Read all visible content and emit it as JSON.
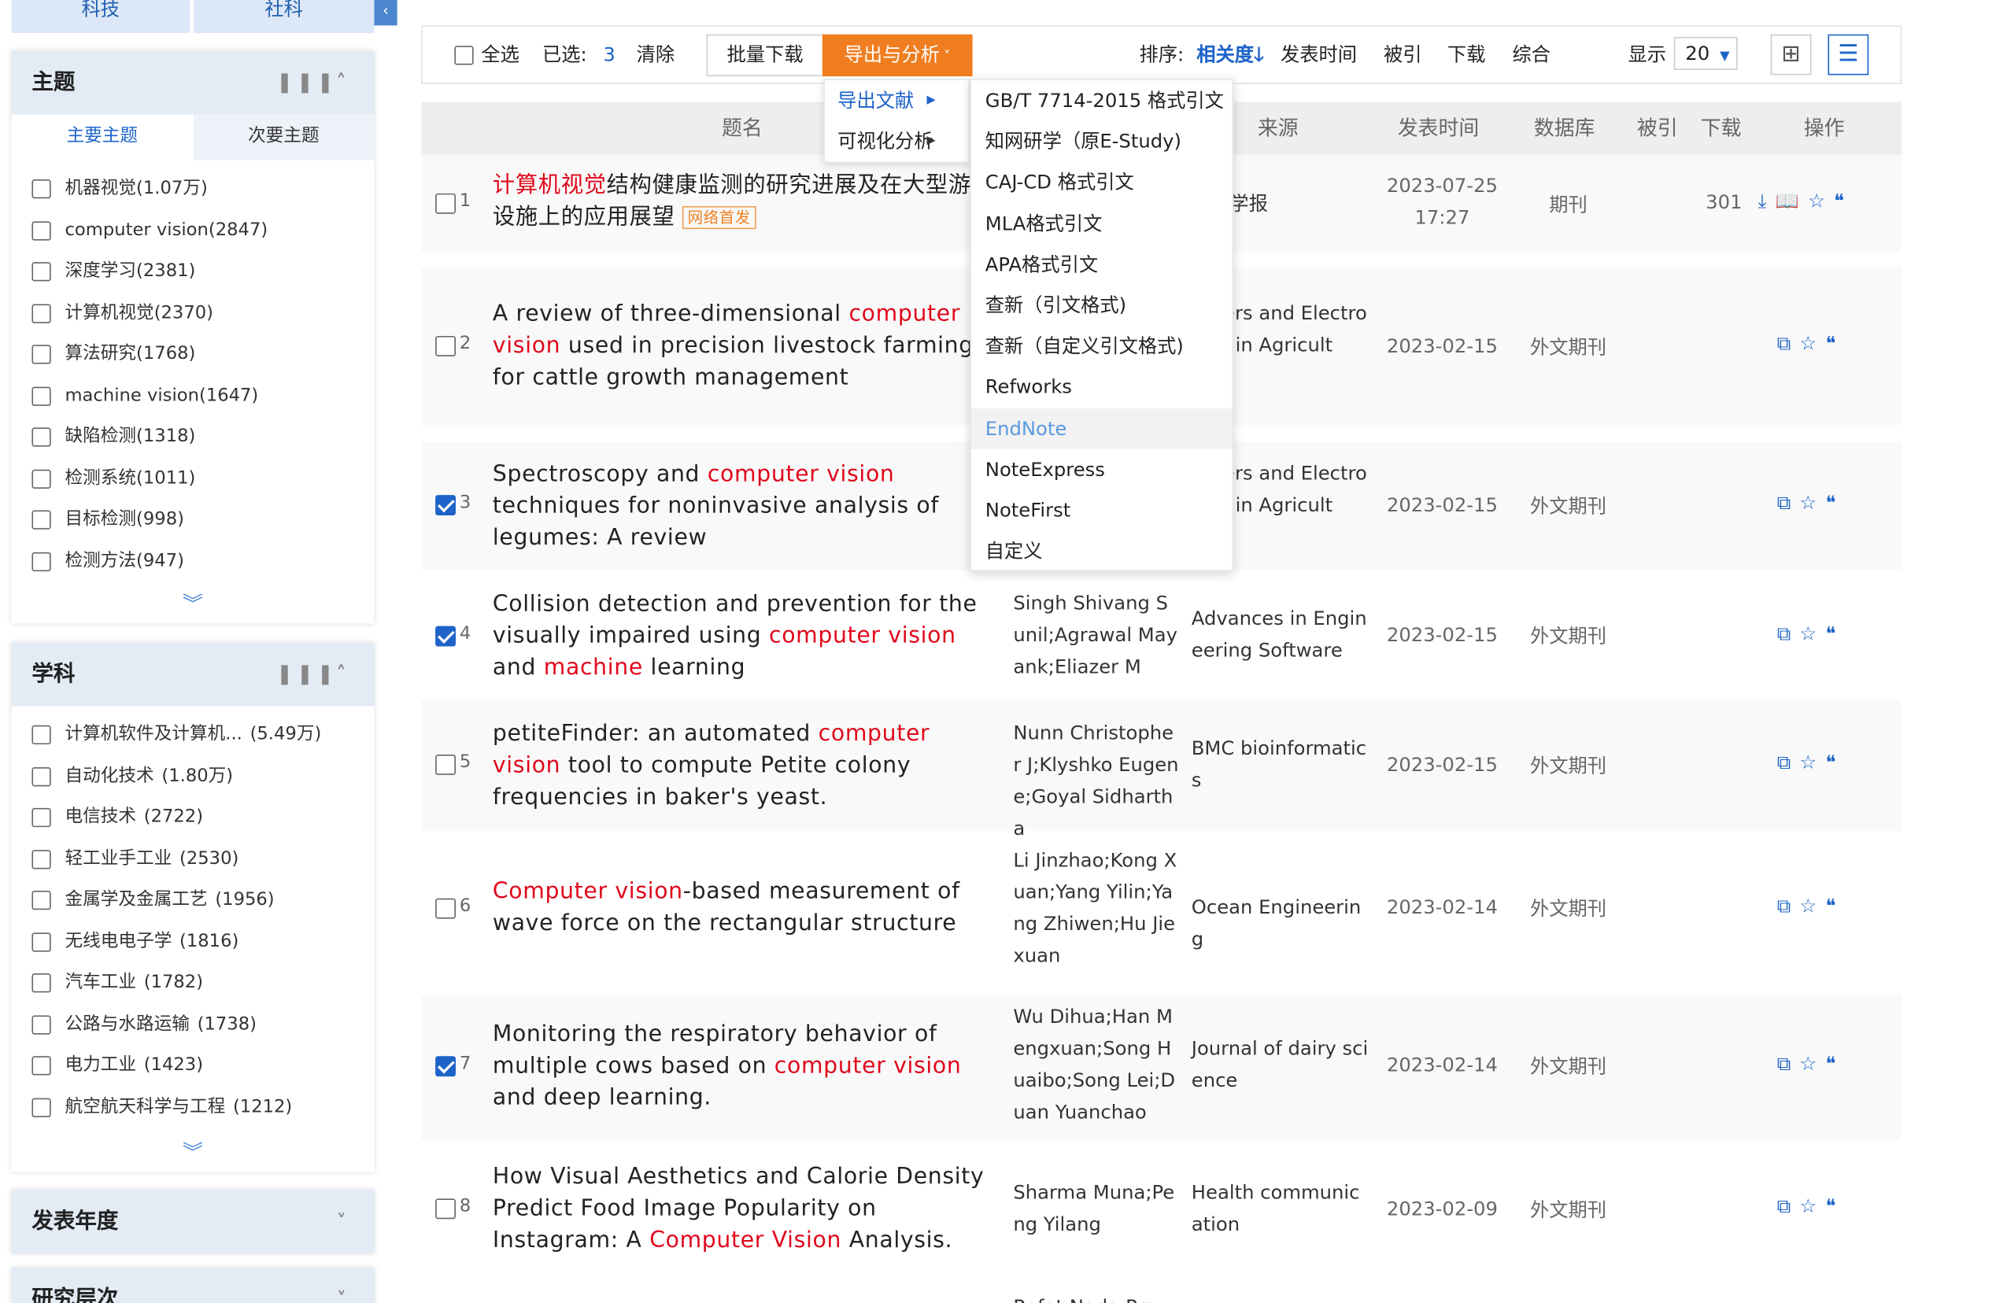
{
  "sidebar": {
    "top_buttons": [
      "科技",
      "社科"
    ],
    "theme_panel": {
      "title": "主题",
      "tabs": [
        "主要主题",
        "次要主题"
      ],
      "items": [
        {
          "label": "机器视觉",
          "count": "(1.07万)"
        },
        {
          "label": "computer vision",
          "count": "(2847)"
        },
        {
          "label": "深度学习",
          "count": "(2381)"
        },
        {
          "label": "计算机视觉",
          "count": "(2370)"
        },
        {
          "label": "算法研究",
          "count": "(1768)"
        },
        {
          "label": "machine vision",
          "count": "(1647)"
        },
        {
          "label": "缺陷检测",
          "count": "(1318)"
        },
        {
          "label": "检测系统",
          "count": "(1011)"
        },
        {
          "label": "目标检测",
          "count": "(998)"
        },
        {
          "label": "检测方法",
          "count": "(947)"
        }
      ]
    },
    "subject_panel": {
      "title": "学科",
      "items": [
        {
          "label": "计算机软件及计算机...",
          "count": "(5.49万)"
        },
        {
          "label": "自动化技术",
          "count": "(1.80万)"
        },
        {
          "label": "电信技术",
          "count": "(2722)"
        },
        {
          "label": "轻工业手工业",
          "count": "(2530)"
        },
        {
          "label": "金属学及金属工艺",
          "count": "(1956)"
        },
        {
          "label": "无线电电子学",
          "count": "(1816)"
        },
        {
          "label": "汽车工业",
          "count": "(1782)"
        },
        {
          "label": "公路与水路运输",
          "count": "(1738)"
        },
        {
          "label": "电力工业",
          "count": "(1423)"
        },
        {
          "label": "航空航天科学与工程",
          "count": "(1212)"
        }
      ]
    },
    "year_panel": {
      "title": "发表年度"
    },
    "level_panel": {
      "title": "研究层次"
    }
  },
  "toolbar": {
    "select_all": "全选",
    "selected_label": "已选:",
    "selected_count": "3",
    "clear": "清除",
    "batch_download": "批量下载",
    "export_analysis": "导出与分析",
    "sort_label": "排序:",
    "sort_relevance": "相关度",
    "sort_date": "发表时间",
    "sort_cited": "被引",
    "sort_download": "下载",
    "sort_composite": "综合",
    "display_label": "显示",
    "display_value": "20"
  },
  "table_header": {
    "title": "题名",
    "source": "来源",
    "date": "发表时间",
    "database": "数据库",
    "cited": "被引",
    "downloads": "下载",
    "actions": "操作"
  },
  "rows": [
    {
      "num": "1",
      "checked": false,
      "title_parts": [
        {
          "t": "计算机视觉",
          "hl": true
        },
        {
          "t": "结构健康监测的研究进展及在大型游乐设施上的应用展望"
        }
      ],
      "badge": "网络首发",
      "authors": "",
      "source": "工程学报",
      "date": "2023-07-25 17:27",
      "database": "期刊",
      "cited": "",
      "downloads": "301"
    },
    {
      "num": "2",
      "checked": false,
      "title_parts": [
        {
          "t": "A review of three-dimensional "
        },
        {
          "t": "computer vision",
          "hl": true
        },
        {
          "t": " used in precision livestock farming for cattle growth management"
        }
      ],
      "authors": "",
      "source": "puters and Electronics in Agricult",
      "date": "2023-02-15",
      "database": "外文期刊",
      "cited": "",
      "downloads": ""
    },
    {
      "num": "3",
      "checked": true,
      "title_parts": [
        {
          "t": "Spectroscopy and "
        },
        {
          "t": "computer vision",
          "hl": true
        },
        {
          "t": " techniques for noninvasive analysis of legumes: A review"
        }
      ],
      "authors": "",
      "source": "puters and Electronics in Agricult",
      "date": "2023-02-15",
      "database": "外文期刊",
      "cited": "",
      "downloads": ""
    },
    {
      "num": "4",
      "checked": true,
      "title_parts": [
        {
          "t": "Collision detection and prevention for the visually impaired using "
        },
        {
          "t": "computer vision",
          "hl": true
        },
        {
          "t": " and "
        },
        {
          "t": "machine",
          "hl": true
        },
        {
          "t": " learning"
        }
      ],
      "authors": "Singh Shivang Sunil;Agrawal Mayank;Eliazer M",
      "source": "Advances in Engineering Software",
      "date": "2023-02-15",
      "database": "外文期刊",
      "cited": "",
      "downloads": ""
    },
    {
      "num": "5",
      "checked": false,
      "title_parts": [
        {
          "t": "petiteFinder: an automated "
        },
        {
          "t": "computer vision",
          "hl": true
        },
        {
          "t": " tool to compute Petite colony frequencies in baker's yeast."
        }
      ],
      "authors": "Nunn Christopher J;Klyshko Eugene;Goyal Sidhartha",
      "source": "BMC bioinformatics",
      "date": "2023-02-15",
      "database": "外文期刊",
      "cited": "",
      "downloads": ""
    },
    {
      "num": "6",
      "checked": false,
      "title_parts": [
        {
          "t": "Computer vision",
          "hl": true
        },
        {
          "t": "-based measurement of wave force on the rectangular structure"
        }
      ],
      "authors": "Li Jinzhao;Kong Xuan;Yang Yilin;Yang Zhiwen;Hu Jiexuan",
      "source": "Ocean Engineering",
      "date": "2023-02-14",
      "database": "外文期刊",
      "cited": "",
      "downloads": ""
    },
    {
      "num": "7",
      "checked": true,
      "title_parts": [
        {
          "t": "Monitoring the respiratory behavior of multiple cows based on "
        },
        {
          "t": "computer vision",
          "hl": true
        },
        {
          "t": " and deep learning."
        }
      ],
      "authors": "Wu Dihua;Han Mengxuan;Song Huaibo;Song Lei;Duan Yuanchao",
      "source": "Journal of dairy science",
      "date": "2023-02-14",
      "database": "外文期刊",
      "cited": "",
      "downloads": ""
    },
    {
      "num": "8",
      "checked": false,
      "title_parts": [
        {
          "t": "How Visual Aesthetics and Calorie Density Predict Food Image Popularity on Instagram: A "
        },
        {
          "t": "Computer Vision",
          "hl": true
        },
        {
          "t": " Analysis."
        }
      ],
      "authors": "Sharma Muna;Peng Yilang",
      "source": "Health communication",
      "date": "2023-02-09",
      "database": "外文期刊",
      "cited": "",
      "downloads": ""
    }
  ],
  "dropdown_left": [
    {
      "label": "导出文献",
      "active": true
    },
    {
      "label": "可视化分析",
      "active": false
    }
  ],
  "dropdown_right": [
    "GB/T 7714-2015 格式引文",
    "知网研学（原E-Study)",
    "CAJ-CD 格式引文",
    "MLA格式引文",
    "APA格式引文",
    "查新（引文格式)",
    "查新（自定义引文格式)",
    "Refworks",
    "EndNote",
    "NoteExpress",
    "NoteFirst",
    "自定义"
  ],
  "dropdown_hover_index": 8,
  "partial_row_authors": "Refat Nada;Prowa"
}
